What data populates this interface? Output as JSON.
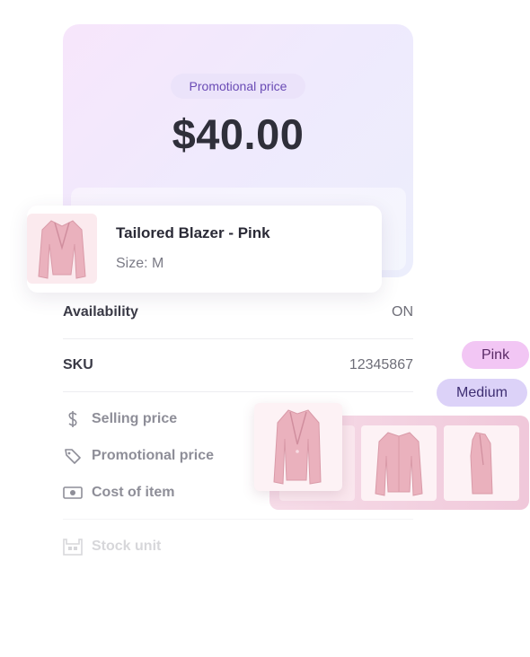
{
  "price_card": {
    "badge": "Promotional price",
    "price": "$40.00"
  },
  "product": {
    "name": "Tailored Blazer - Pink",
    "size": "Size: M"
  },
  "rows": [
    {
      "label": "Availability",
      "value": "ON"
    },
    {
      "label": "SKU",
      "value": "12345867"
    }
  ],
  "menu": [
    {
      "label": "Selling price",
      "icon": "dollar-icon"
    },
    {
      "label": "Promotional price",
      "icon": "tag-icon"
    },
    {
      "label": "Cost of item",
      "icon": "cash-icon"
    },
    {
      "label": "Stock unit",
      "icon": "warehouse-icon"
    }
  ],
  "tags": {
    "color": "Pink",
    "size": "Medium"
  },
  "colors": {
    "accent": "#6a4bb5",
    "pink_tag_bg": "#f2c6f4",
    "medium_tag_bg": "#dcd2f8",
    "blazer": "#eab1bd"
  }
}
